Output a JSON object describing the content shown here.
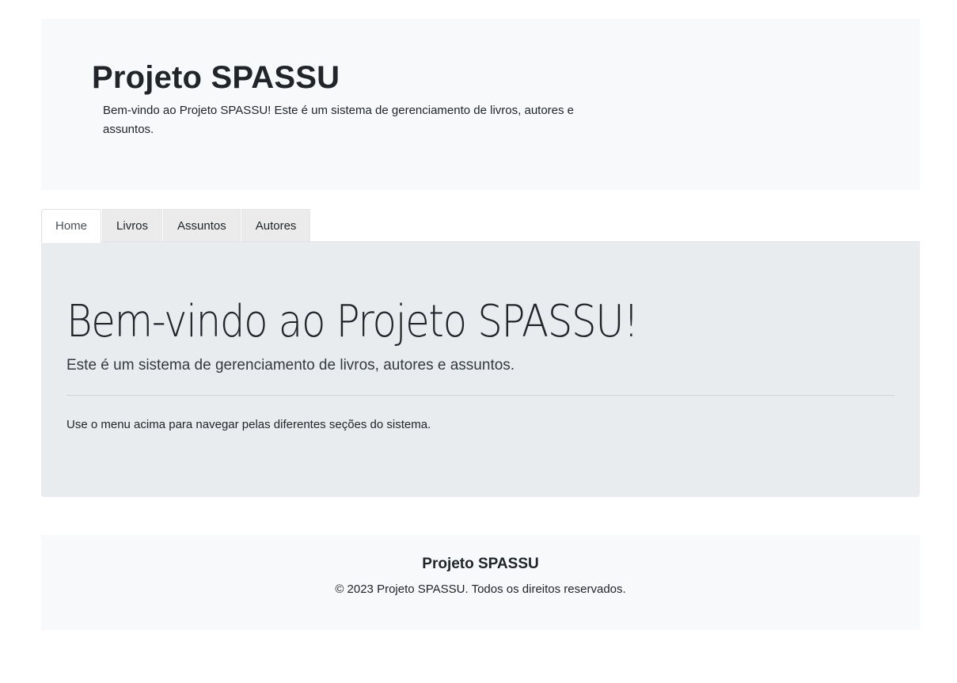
{
  "header": {
    "title": "Projeto SPASSU",
    "description": "Bem-vindo ao Projeto SPASSU! Este é um sistema de gerenciamento de livros, autores e assuntos."
  },
  "nav": {
    "tabs": [
      {
        "label": "Home",
        "active": true
      },
      {
        "label": "Livros",
        "active": false
      },
      {
        "label": "Assuntos",
        "active": false
      },
      {
        "label": "Autores",
        "active": false
      }
    ]
  },
  "main": {
    "title": "Bem-vindo ao Projeto SPASSU!",
    "lead": "Este é um sistema de gerenciamento de livros, autores e assuntos.",
    "text": "Use o menu acima para navegar pelas diferentes seções do sistema."
  },
  "footer": {
    "title": "Projeto SPASSU",
    "copyright": "© 2023 Projeto SPASSU. Todos os direitos reservados."
  },
  "colors": {
    "header_bg": "#f8f9fa",
    "jumbotron_bg": "#e9ecef",
    "inactive_tab_bg": "#ebebeb",
    "text": "#212529"
  }
}
